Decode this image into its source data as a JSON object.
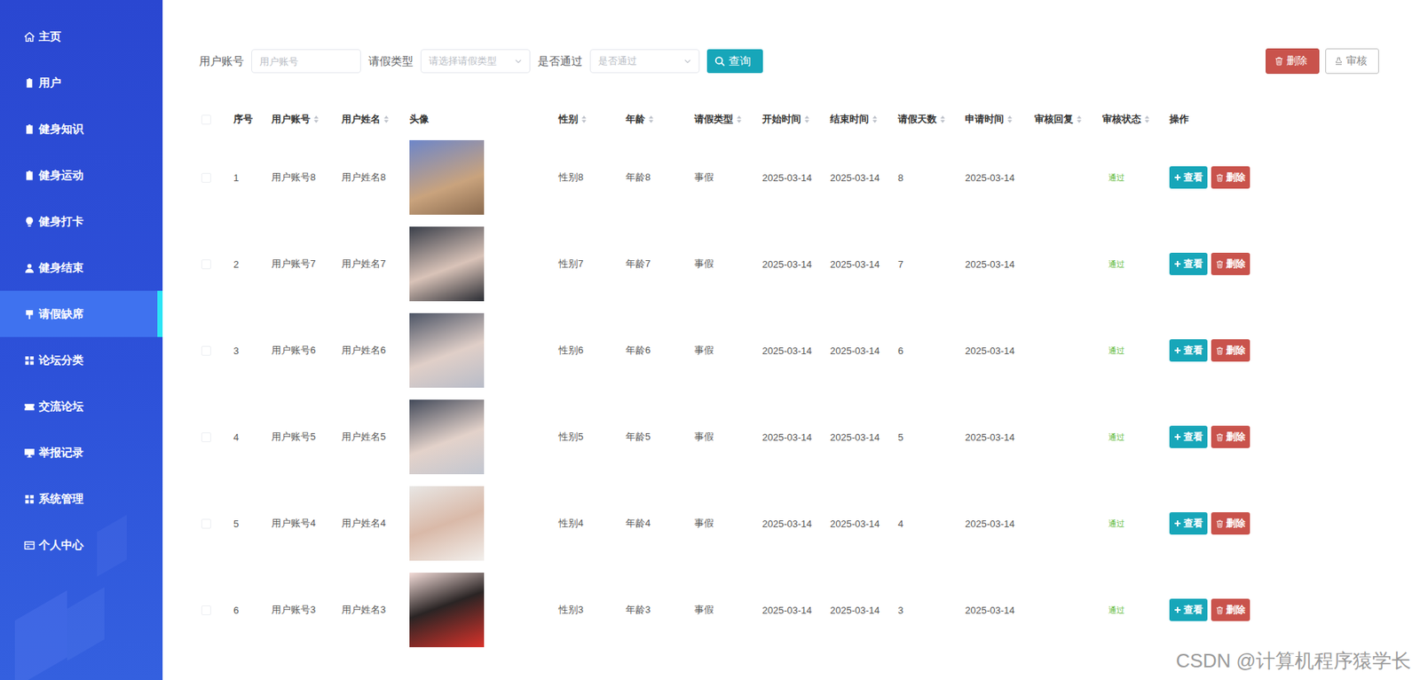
{
  "sidebar": {
    "items": [
      {
        "label": "主页",
        "selected": false
      },
      {
        "label": "用户",
        "selected": false
      },
      {
        "label": "健身知识",
        "selected": false
      },
      {
        "label": "健身运动",
        "selected": false
      },
      {
        "label": "健身打卡",
        "selected": false
      },
      {
        "label": "健身结束",
        "selected": false
      },
      {
        "label": "请假缺席",
        "selected": true
      },
      {
        "label": "论坛分类",
        "selected": false
      },
      {
        "label": "交流论坛",
        "selected": false
      },
      {
        "label": "举报记录",
        "selected": false
      },
      {
        "label": "系统管理",
        "selected": false
      },
      {
        "label": "个人中心",
        "selected": false
      }
    ]
  },
  "filters": [
    {
      "label": "用户账号",
      "kind": "input",
      "placeholder": "用户账号"
    },
    {
      "label": "请假类型",
      "kind": "select",
      "placeholder": "请选择请假类型"
    },
    {
      "label": "是否通过",
      "kind": "select",
      "placeholder": "是否通过"
    }
  ],
  "search_button": "查询",
  "toolbar_buttons": [
    {
      "label": "删除",
      "kind": "danger"
    },
    {
      "label": "审核",
      "kind": "plain"
    }
  ],
  "table": {
    "header_checked": false,
    "columns": [
      {
        "label": "序号",
        "sortable": false
      },
      {
        "label": "用户账号",
        "sortable": true
      },
      {
        "label": "用户姓名",
        "sortable": true
      },
      {
        "label": "头像",
        "sortable": false
      },
      {
        "label": "性别",
        "sortable": true
      },
      {
        "label": "年龄",
        "sortable": true
      },
      {
        "label": "请假类型",
        "sortable": true
      },
      {
        "label": "开始时间",
        "sortable": true
      },
      {
        "label": "结束时间",
        "sortable": true
      },
      {
        "label": "请假天数",
        "sortable": true
      },
      {
        "label": "申请时间",
        "sortable": true
      },
      {
        "label": "审核回复",
        "sortable": true
      },
      {
        "label": "审核状态",
        "sortable": true
      },
      {
        "label": "操作",
        "sortable": false
      }
    ],
    "row_actions": [
      {
        "label": "查看",
        "kind": "info"
      },
      {
        "label": "删除",
        "kind": "danger"
      }
    ],
    "rows": [
      {
        "checked": false,
        "index": "1",
        "account": "用户账号8",
        "name": "用户姓名8",
        "gender": "性别8",
        "age": "年龄8",
        "leave_type": "事假",
        "start": "2025-03-14",
        "end": "2025-03-14",
        "days": "8",
        "applied": "2025-03-14",
        "reply": "",
        "status": "通过"
      },
      {
        "checked": false,
        "index": "2",
        "account": "用户账号7",
        "name": "用户姓名7",
        "gender": "性别7",
        "age": "年龄7",
        "leave_type": "事假",
        "start": "2025-03-14",
        "end": "2025-03-14",
        "days": "7",
        "applied": "2025-03-14",
        "reply": "",
        "status": "通过"
      },
      {
        "checked": false,
        "index": "3",
        "account": "用户账号6",
        "name": "用户姓名6",
        "gender": "性别6",
        "age": "年龄6",
        "leave_type": "事假",
        "start": "2025-03-14",
        "end": "2025-03-14",
        "days": "6",
        "applied": "2025-03-14",
        "reply": "",
        "status": "通过"
      },
      {
        "checked": false,
        "index": "4",
        "account": "用户账号5",
        "name": "用户姓名5",
        "gender": "性别5",
        "age": "年龄5",
        "leave_type": "事假",
        "start": "2025-03-14",
        "end": "2025-03-14",
        "days": "5",
        "applied": "2025-03-14",
        "reply": "",
        "status": "通过"
      },
      {
        "checked": false,
        "index": "5",
        "account": "用户账号4",
        "name": "用户姓名4",
        "gender": "性别4",
        "age": "年龄4",
        "leave_type": "事假",
        "start": "2025-03-14",
        "end": "2025-03-14",
        "days": "4",
        "applied": "2025-03-14",
        "reply": "",
        "status": "通过"
      },
      {
        "checked": false,
        "index": "6",
        "account": "用户账号3",
        "name": "用户姓名3",
        "gender": "性别3",
        "age": "年龄3",
        "leave_type": "事假",
        "start": "2025-03-14",
        "end": "2025-03-14",
        "days": "3",
        "applied": "2025-03-14",
        "reply": "",
        "status": "通过"
      }
    ]
  },
  "watermark": "CSDN @计算机程序猿学长"
}
